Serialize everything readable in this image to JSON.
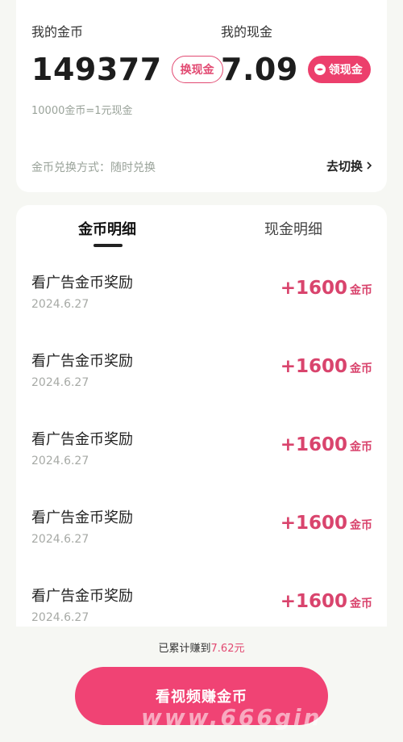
{
  "wallet": {
    "coin_label": "我的金币",
    "coin_amount": "149377",
    "exchange_label": "换现金",
    "cash_label": "我的现金",
    "cash_amount": "7.09",
    "claim_label": "领现金",
    "rate_note": "10000金币=1元现金",
    "method_text": "金币兑换方式：随时兑换",
    "switch_label": "去切换"
  },
  "tabs": [
    {
      "label": "金币明细",
      "active": true
    },
    {
      "label": "现金明细",
      "active": false
    }
  ],
  "records": [
    {
      "title": "看广告金币奖励",
      "date": "2024.6.27",
      "amount": "+1600",
      "unit": "金币"
    },
    {
      "title": "看广告金币奖励",
      "date": "2024.6.27",
      "amount": "+1600",
      "unit": "金币"
    },
    {
      "title": "看广告金币奖励",
      "date": "2024.6.27",
      "amount": "+1600",
      "unit": "金币"
    },
    {
      "title": "看广告金币奖励",
      "date": "2024.6.27",
      "amount": "+1600",
      "unit": "金币"
    },
    {
      "title": "看广告金币奖励",
      "date": "2024.6.27",
      "amount": "+1600",
      "unit": "金币"
    }
  ],
  "footer": {
    "earned_prefix": "已累计赚到",
    "earned_value": "7.62元",
    "cta_label": "看视频赚金币",
    "watermark": "www.666gin"
  },
  "colors": {
    "accent": "#ec3f6c",
    "amount_text": "#d9446d",
    "background": "#f6f7f3"
  },
  "icons": {
    "claim": "wallet-icon",
    "switch": "chevron-right-icon"
  }
}
